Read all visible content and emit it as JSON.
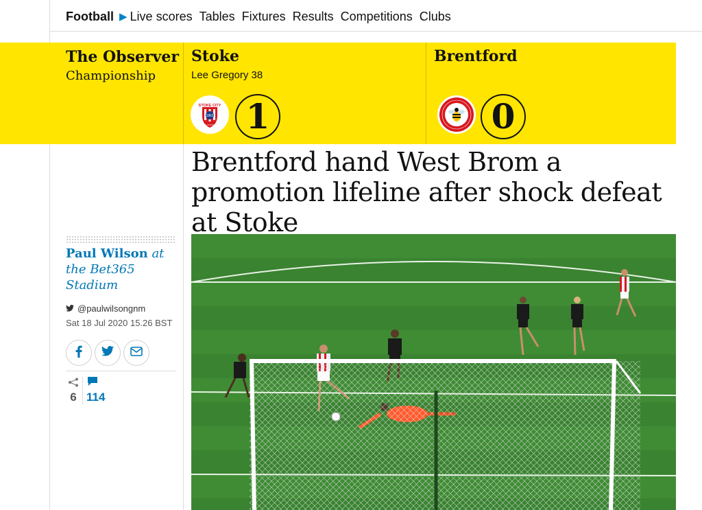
{
  "nav": {
    "section": "Football",
    "items": [
      "Live scores",
      "Tables",
      "Fixtures",
      "Results",
      "Competitions",
      "Clubs"
    ]
  },
  "match": {
    "publication": "The Observer",
    "competition": "Championship",
    "home": {
      "name": "Stoke",
      "score": "1",
      "scorer": "Lee Gregory 38",
      "crest_text": "STOKE CITY",
      "crest_motto": "THE POTTERS"
    },
    "away": {
      "name": "Brentford",
      "score": "0",
      "crest_text": "BRENTFORD",
      "crest_subtext": "FOOTBALL CLUB"
    }
  },
  "headline": "Brentford hand West Brom a promotion lifeline after shock defeat at Stoke",
  "byline": {
    "author": "Paul Wilson",
    "location": "at the Bet365 Stadium",
    "twitter": "@paulwilsongnm",
    "date": "Sat 18 Jul 2020 15.26 BST"
  },
  "share": {
    "count": "6",
    "comments": "114"
  },
  "colors": {
    "band": "#ffe500",
    "link": "#0077b6",
    "pitch": "#3f8c35"
  },
  "icons": {
    "facebook": "facebook-icon",
    "twitter": "twitter-icon",
    "email": "email-icon",
    "share": "share-icon",
    "comment": "comment-icon"
  }
}
